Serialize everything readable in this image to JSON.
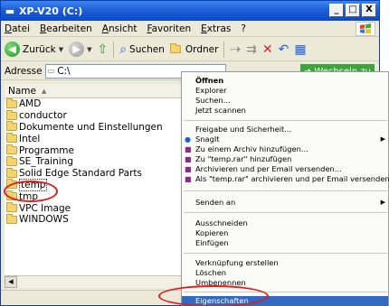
{
  "window": {
    "title": "XP-V20 (C:)",
    "buttons": {
      "minimize": "_",
      "maximize": "□",
      "close": "X"
    }
  },
  "menubar": [
    "Datei",
    "Bearbeiten",
    "Ansicht",
    "Favoriten",
    "Extras",
    "?"
  ],
  "toolbar": {
    "back_label": "Zurück",
    "search_label": "Suchen",
    "folders_label": "Ordner"
  },
  "address": {
    "label": "Adresse",
    "value": "C:\\",
    "go_label": "Wechseln zu"
  },
  "filelist": {
    "column_name": "Name",
    "items": [
      "AMD",
      "conductor",
      "Dokumente und Einstellungen",
      "Intel",
      "Programme",
      "SE_Training",
      "Solid Edge Standard Parts",
      "temp",
      "tmp",
      "VPC Image",
      "WINDOWS"
    ],
    "selected": "temp"
  },
  "context_menu": {
    "open": "Öffnen",
    "explorer": "Explorer",
    "search": "Suchen...",
    "scan": "Jetzt scannen",
    "share": "Freigabe und Sicherheit...",
    "snagit": "SnagIt",
    "add_archive": "Zu einem Archiv hinzufügen...",
    "add_temp_rar": "Zu \"temp.rar\" hinzufügen",
    "archive_email": "Archivieren und per Email versenden...",
    "temp_rar_email": "Als \"temp.rar\" archivieren und per Email versenden",
    "send_to": "Senden an",
    "cut": "Ausschneiden",
    "copy": "Kopieren",
    "paste": "Einfügen",
    "create_shortcut": "Verknüpfung erstellen",
    "delete": "Löschen",
    "rename": "Umbenennen",
    "properties": "Eigenschaften"
  },
  "colors": {
    "titlebar": "#0a48c8",
    "highlight": "#316ac5",
    "annotation": "#e21b1b"
  }
}
